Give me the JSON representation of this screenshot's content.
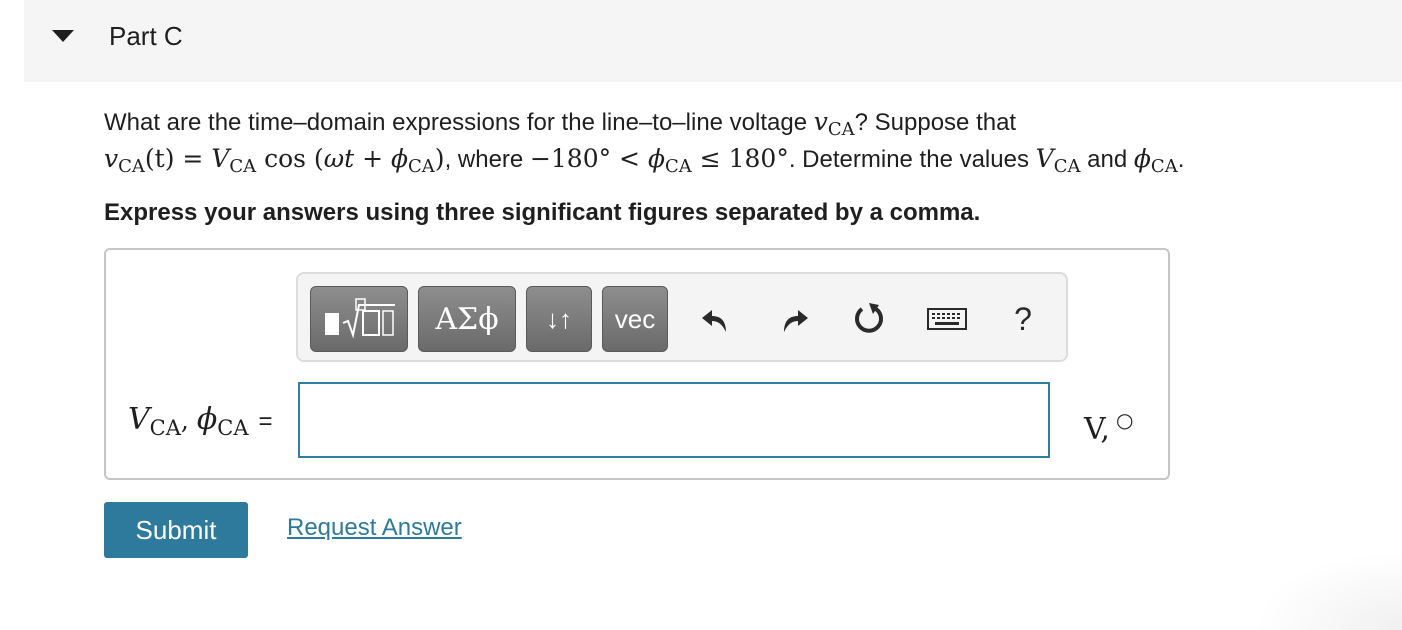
{
  "part": {
    "title": "Part C"
  },
  "question": {
    "intro": "What are the time–domain expressions for the line–to–line voltage ",
    "v_var": "v",
    "sub_ca": "CA",
    "q_mark": "? Suppose that",
    "t_paren": "(t)",
    "equals": " = ",
    "V_var": "V",
    "cos": " cos (",
    "omega_t": "ωt",
    "plus": " + ",
    "phi": "ϕ",
    "close_paren": ")",
    "where": ", where ",
    "neg180": "−180°",
    "lt": " < ",
    "le": " ≤ ",
    "pos180": "180°",
    "determine": ". Determine the values ",
    "and": " and ",
    "period": "."
  },
  "instruction": "Express your answers using three significant figures separated by a comma.",
  "toolbar": {
    "symbols_label": "ΑΣϕ",
    "updown_label": "↓↑",
    "vec_label": "vec",
    "help_label": "?"
  },
  "answer": {
    "label_V": "V",
    "label_sub": "CA",
    "label_comma": ", ",
    "label_phi": "ϕ",
    "label_eq": "=",
    "input_value": "",
    "units_text": "V,",
    "units_deg": "○"
  },
  "actions": {
    "submit_label": "Submit",
    "request_label": "Request Answer"
  },
  "colors": {
    "accent": "#2e7a9c",
    "input_border": "#2e7fa3",
    "header_bg": "#f5f5f5"
  },
  "icons": [
    "triangle-down-icon",
    "templates-icon",
    "undo-icon",
    "redo-icon",
    "reset-icon",
    "keyboard-icon",
    "help-icon"
  ]
}
